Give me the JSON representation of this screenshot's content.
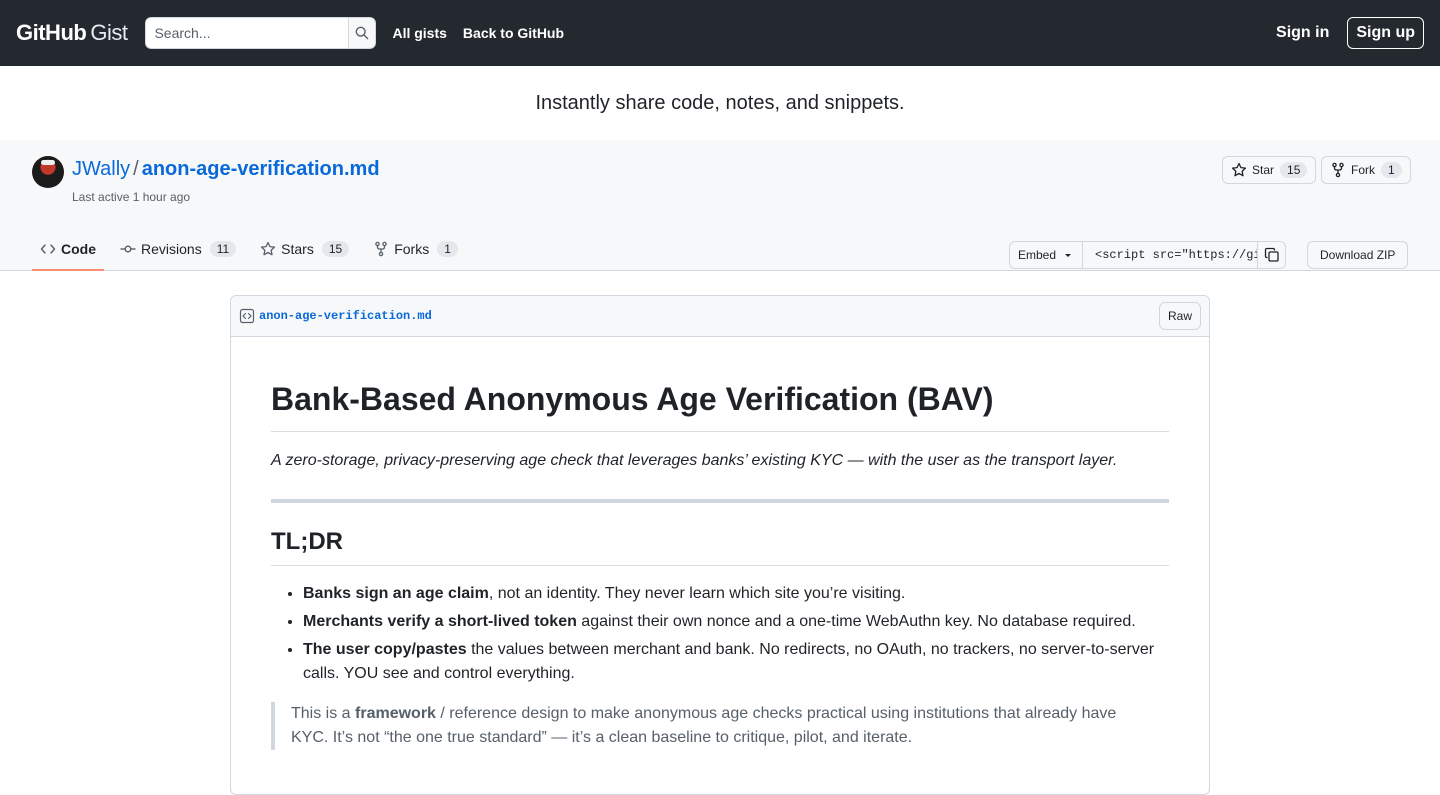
{
  "header": {
    "logo_github": "GitHub",
    "logo_gist": "Gist",
    "search_placeholder": "Search...",
    "nav": [
      "All gists",
      "Back to GitHub"
    ],
    "sign_in": "Sign in",
    "sign_up": "Sign up"
  },
  "tagline": "Instantly share code, notes, and snippets.",
  "gist": {
    "owner": "JWally",
    "separator": "/",
    "filename": "anon-age-verification.md",
    "last_active": "Last active 1 hour ago",
    "star_label": "Star",
    "star_count": "15",
    "fork_label": "Fork",
    "fork_count": "1"
  },
  "tabs": [
    {
      "label": "Code",
      "icon": "code-icon",
      "count": ""
    },
    {
      "label": "Revisions",
      "icon": "commit-icon",
      "count": "11"
    },
    {
      "label": "Stars",
      "icon": "star-icon",
      "count": "15"
    },
    {
      "label": "Forks",
      "icon": "fork-icon",
      "count": "1"
    }
  ],
  "embed": {
    "label": "Embed",
    "code": "<script src=\"https://gist.github.com/JWally/",
    "download_zip": "Download ZIP"
  },
  "file": {
    "name": "anon-age-verification.md",
    "raw": "Raw"
  },
  "content": {
    "h1": "Bank-Based Anonymous Age Verification (BAV)",
    "lede": "A zero-storage, privacy-preserving age check that leverages banks’ existing KYC — with the user as the transport layer.",
    "h2": "TL;DR",
    "bullets": [
      {
        "bold": "Banks sign an age claim",
        "text": ", not an identity. They never learn which site you’re visiting."
      },
      {
        "bold": "Merchants verify a short-lived token",
        "text": " against their own nonce and a one-time WebAuthn key. No database required."
      },
      {
        "bold": "The user copy/pastes",
        "text": " the values between merchant and bank. No redirects, no OAuth, no trackers, no server-to-server calls. YOU see and control everything."
      }
    ],
    "quote_pre": "This is a ",
    "quote_bold": "framework",
    "quote_post": " / reference design to make anonymous age checks practical using institutions that already have KYC. It’s not “the one true standard” — it’s a clean baseline to critique, pilot, and iterate."
  },
  "colors": {
    "header_bg": "#24292f",
    "link": "#0969da",
    "active_tab_underline": "#fd8c73"
  }
}
